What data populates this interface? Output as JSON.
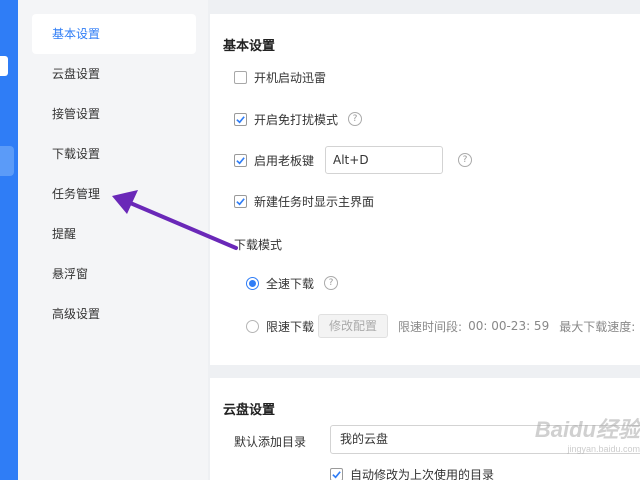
{
  "sidebar": {
    "items": [
      {
        "label": "基本设置",
        "active": true
      },
      {
        "label": "云盘设置"
      },
      {
        "label": "接管设置"
      },
      {
        "label": "下载设置"
      },
      {
        "label": "任务管理"
      },
      {
        "label": "提醒"
      },
      {
        "label": "悬浮窗"
      },
      {
        "label": "高级设置"
      }
    ]
  },
  "basic": {
    "title": "基本设置",
    "startup": {
      "label": "开机启动迅雷",
      "checked": false
    },
    "no_disturb": {
      "label": "开启免打扰模式",
      "checked": true
    },
    "boss_key": {
      "label": "启用老板键",
      "checked": true,
      "value": "Alt+D"
    },
    "show_main": {
      "label": "新建任务时显示主界面",
      "checked": true
    },
    "help_glyph": "?",
    "download_mode": {
      "title": "下载模式",
      "full_speed": {
        "label": "全速下载",
        "selected": true
      },
      "limited": {
        "label": "限速下载",
        "selected": false,
        "button": "修改配置",
        "time_label": "限速时间段:",
        "time_value": "00: 00-23: 59",
        "max_label": "最大下载速度:"
      }
    }
  },
  "cloud": {
    "title": "云盘设置",
    "default_dir_label": "默认添加目录",
    "default_dir_value": "我的云盘",
    "auto_change": {
      "label": "自动修改为上次使用的目录",
      "checked": true
    }
  },
  "watermark": {
    "text": "Baidu经验",
    "sub": "jingyan.baidu.com"
  },
  "colors": {
    "accent": "#2f7df6",
    "arrow": "#6a28b8"
  }
}
